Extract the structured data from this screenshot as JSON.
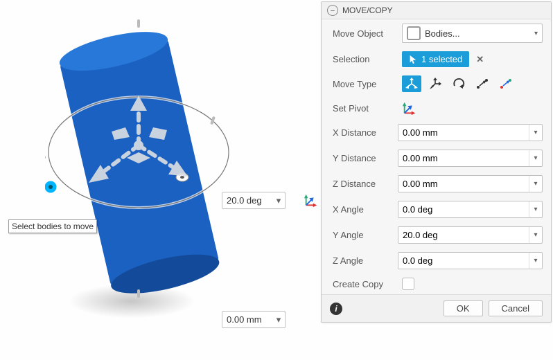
{
  "panel": {
    "title": "MOVE/COPY",
    "moveObject": {
      "label": "Move Object",
      "value": "Bodies..."
    },
    "selection": {
      "label": "Selection",
      "badge": "1 selected"
    },
    "moveType": {
      "label": "Move Type"
    },
    "setPivot": {
      "label": "Set Pivot"
    },
    "xDistance": {
      "label": "X Distance",
      "value": "0.00 mm"
    },
    "yDistance": {
      "label": "Y Distance",
      "value": "0.00 mm"
    },
    "zDistance": {
      "label": "Z Distance",
      "value": "0.00 mm"
    },
    "xAngle": {
      "label": "X Angle",
      "value": "0.0 deg"
    },
    "yAngle": {
      "label": "Y Angle",
      "value": "20.0 deg"
    },
    "zAngle": {
      "label": "Z Angle",
      "value": "0.0 deg"
    },
    "createCopy": {
      "label": "Create Copy"
    },
    "ok": "OK",
    "cancel": "Cancel"
  },
  "viewport": {
    "angleInput": "20.0 deg",
    "distInput": "0.00 mm",
    "tooltip": "Select bodies to move"
  },
  "colors": {
    "accent": "#1a9dd9",
    "cylinder": "#1b61c2",
    "cylinderTop": "#2778d9"
  }
}
